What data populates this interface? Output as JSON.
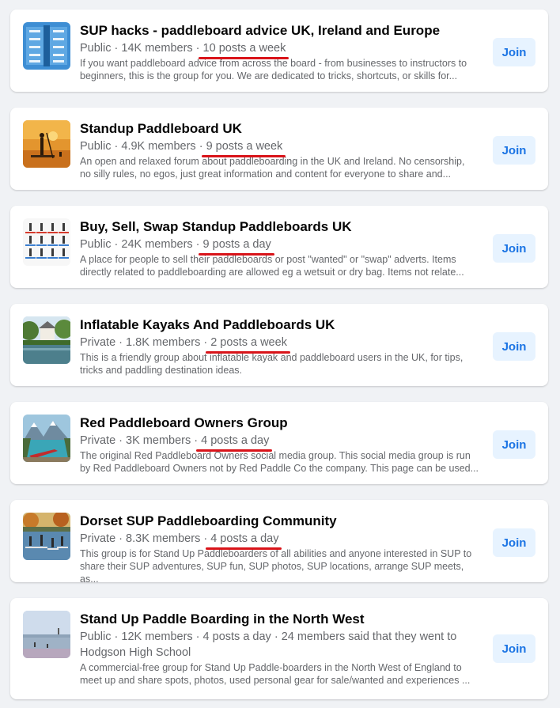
{
  "groups": [
    {
      "name": "SUP hacks - paddleboard advice UK, Ireland and Europe",
      "privacy": "Public",
      "members": "14K members",
      "activity": "10 posts a week",
      "extra": "",
      "extra2": "",
      "desc1": "If you want paddleboard advice from across the board - from businesses to instructors to",
      "desc2": "beginners, this is the group for you. We are dedicated to tricks, shortcuts, or skills for...",
      "join_label": "Join",
      "thumb_icon": "sup-infographic-thumbnail"
    },
    {
      "name": "Standup Paddleboard UK",
      "privacy": "Public",
      "members": "4.9K members",
      "activity": "9 posts a week",
      "extra": "",
      "extra2": "",
      "desc1": "An open and relaxed forum about paddleboarding in the UK and Ireland. No censorship,",
      "desc2": "no silly rules, no egos, just great information and content for everyone to share and...",
      "join_label": "Join",
      "thumb_icon": "sunset-paddler-thumbnail"
    },
    {
      "name": "Buy, Sell, Swap Standup Paddleboards UK",
      "privacy": "Public",
      "members": "24K members",
      "activity": "9 posts a day",
      "extra": "",
      "extra2": "",
      "desc1": "A place for people to sell their paddleboards or post \"wanted\" or \"swap\" adverts. Items",
      "desc2": "directly related to paddleboarding are allowed eg a wetsuit or dry bag. Items not relate...",
      "join_label": "Join",
      "thumb_icon": "paddlers-grid-thumbnail"
    },
    {
      "name": "Inflatable Kayaks And Paddleboards UK",
      "privacy": "Private",
      "members": "1.8K members",
      "activity": "2 posts a week",
      "extra": "",
      "extra2": "",
      "desc1": "This is a friendly group about inflatable kayak and paddleboard users in the UK, for tips,",
      "desc2": "tricks and paddling destination ideas.",
      "join_label": "Join",
      "thumb_icon": "river-house-thumbnail"
    },
    {
      "name": "Red Paddleboard Owners Group",
      "privacy": "Private",
      "members": "3K members",
      "activity": "4 posts a day",
      "extra": "",
      "extra2": "",
      "desc1": "The original Red Paddleboard Owners social media group. This social media group is run",
      "desc2": "by Red Paddleboard Owners not by Red Paddle Co the company. This page can be used...",
      "join_label": "Join",
      "thumb_icon": "mountain-lake-thumbnail"
    },
    {
      "name": "Dorset SUP Paddleboarding Community",
      "privacy": "Private",
      "members": "8.3K members",
      "activity": "4 posts a day",
      "extra": "",
      "extra2": "",
      "desc1": "This group is for Stand Up Paddleboarders of all abilities and anyone interested in SUP to",
      "desc2": "share their SUP adventures, SUP fun, SUP photos, SUP locations, arrange SUP meets, as...",
      "join_label": "Join",
      "thumb_icon": "group-paddle-thumbnail"
    },
    {
      "name": "Stand Up Paddle Boarding in the North West",
      "privacy": "Public",
      "members": "12K members",
      "activity": "4 posts a day",
      "extra": "24 members said that they went to",
      "extra2": "Hodgson High School",
      "desc1": "A commercial-free group for Stand Up Paddle-boarders in the North West of England to",
      "desc2": "meet up and share spots, photos, used personal gear for sale/wanted and experiences ...",
      "join_label": "Join",
      "thumb_icon": "beach-horizon-thumbnail"
    }
  ]
}
